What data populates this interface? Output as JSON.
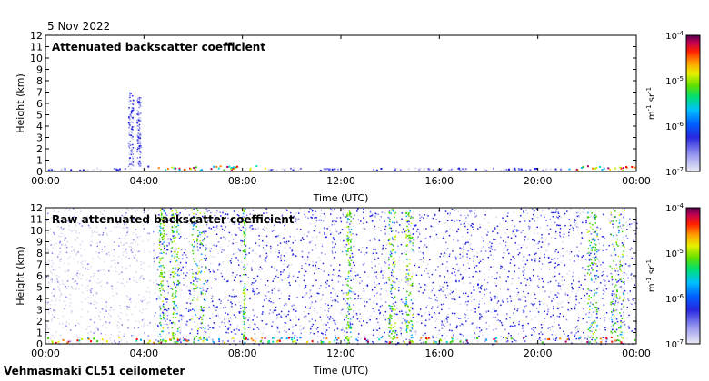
{
  "date": "5 Nov 2022",
  "instrument": "Vehmasmaki CL51 ceilometer",
  "colorbar_labels": [
    {
      "base": "10",
      "exp": "-4"
    },
    {
      "base": "10",
      "exp": "-5"
    },
    {
      "base": "10",
      "exp": "-6"
    },
    {
      "base": "10",
      "exp": "-7"
    }
  ],
  "colorbar_unit": {
    "m": "m",
    "m_exp": "-1",
    "sr": " sr",
    "sr_exp": "-1"
  },
  "colors": {
    "colormap": [
      "#d8d8f0",
      "#8080f0",
      "#2020e0",
      "#0050ff",
      "#00a8ff",
      "#00e0c0",
      "#30d000",
      "#c0f000",
      "#ffe000",
      "#ff8000",
      "#ff0000",
      "#b00060",
      "#601040"
    ]
  },
  "chart_data": [
    {
      "type": "heatmap",
      "title": "Attenuated backscatter coefficient",
      "xlabel": "Time (UTC)",
      "ylabel": "Height (km)",
      "x_ticks": [
        "00:00",
        "04:00",
        "08:00",
        "12:00",
        "16:00",
        "20:00",
        "00:00"
      ],
      "y_ticks": [
        "0",
        "1",
        "2",
        "3",
        "4",
        "5",
        "6",
        "7",
        "8",
        "9",
        "10",
        "11",
        "12"
      ],
      "xlim_hours": [
        0,
        24
      ],
      "ylim_km": [
        0,
        12
      ],
      "colorbar_range": [
        1e-07,
        0.0001
      ],
      "colorbar_scale": "log",
      "features": [
        {
          "name": "cloud/precipitation column",
          "time_start_h": 3.35,
          "time_end_h": 3.55,
          "height_top_km": 7.0
        },
        {
          "name": "cloud/precipitation column",
          "time_start_h": 3.7,
          "time_end_h": 3.85,
          "height_top_km": 6.8
        },
        {
          "name": "near-surface layer",
          "time_start_h": 0,
          "time_end_h": 24,
          "height_top_km": 0.4
        }
      ]
    },
    {
      "type": "heatmap",
      "title": "Raw attenuated backscatter coefficient",
      "xlabel": "Time (UTC)",
      "ylabel": "Height (km)",
      "x_ticks": [
        "00:00",
        "04:00",
        "08:00",
        "12:00",
        "16:00",
        "20:00",
        "00:00"
      ],
      "y_ticks": [
        "0",
        "1",
        "2",
        "3",
        "4",
        "5",
        "6",
        "7",
        "8",
        "9",
        "10",
        "11",
        "12"
      ],
      "xlim_hours": [
        0,
        24
      ],
      "ylim_km": [
        0,
        12
      ],
      "colorbar_range": [
        1e-07,
        0.0001
      ],
      "colorbar_scale": "log",
      "features": [
        {
          "name": "low-signal region",
          "time_start_h": 0,
          "time_end_h": 4.5
        },
        {
          "name": "strong signal streak",
          "time_start_h": 4.6,
          "time_end_h": 4.8
        },
        {
          "name": "strong signal streak",
          "time_start_h": 5.1,
          "time_end_h": 5.4
        },
        {
          "name": "strong signal streak",
          "time_start_h": 5.9,
          "time_end_h": 6.5
        },
        {
          "name": "strong signal streak",
          "time_start_h": 8.0,
          "time_end_h": 8.1
        },
        {
          "name": "strong signal streak",
          "time_start_h": 12.2,
          "time_end_h": 12.4
        },
        {
          "name": "strong signal streak",
          "time_start_h": 13.9,
          "time_end_h": 14.2
        },
        {
          "name": "strong signal streak",
          "time_start_h": 14.6,
          "time_end_h": 14.9
        },
        {
          "name": "strong signal streak",
          "time_start_h": 22.0,
          "time_end_h": 22.4
        },
        {
          "name": "strong signal streak",
          "time_start_h": 22.9,
          "time_end_h": 23.5
        }
      ]
    }
  ]
}
